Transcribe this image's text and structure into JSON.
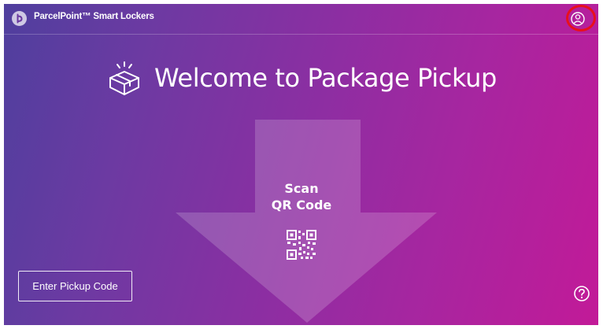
{
  "topbar": {
    "app_title": "ParcelPoint™ Smart Lockers",
    "logo_icon": "parcelpoint-logo",
    "account_icon": "user-account-icon",
    "highlight_color": "#e8101c"
  },
  "welcome": {
    "title": "Welcome to Package Pickup",
    "icon": "package-box-icon"
  },
  "scan": {
    "line1": "Scan",
    "line2": "QR Code",
    "icon": "qr-code-icon"
  },
  "actions": {
    "enter_code_label": "Enter Pickup Code",
    "help_icon": "help-icon"
  },
  "colors": {
    "gradient_start": "#4f3f9e",
    "gradient_end": "#c21a98",
    "text": "#ffffff"
  }
}
